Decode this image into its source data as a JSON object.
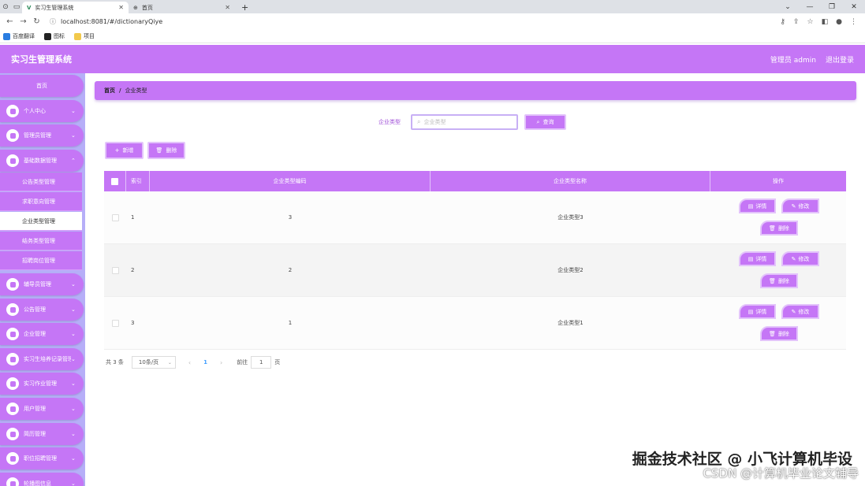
{
  "browser": {
    "tabs": [
      {
        "title": "实习生管理系统",
        "active": true
      },
      {
        "title": "首页",
        "active": false
      }
    ],
    "new_tab": "+",
    "url": "localhost:8081/#/dictionaryQiye",
    "bookmarks": [
      "百度翻译",
      "图标",
      "项目"
    ]
  },
  "header": {
    "title": "实习生管理系统",
    "user": "管理员 admin",
    "logout": "退出登录"
  },
  "sidebar": {
    "home": "首页",
    "menus": [
      {
        "label": "个人中心"
      },
      {
        "label": "管理员管理"
      },
      {
        "label": "基础数据管理"
      }
    ],
    "submenus": [
      "公告类型管理",
      "求职意向管理",
      "企业类型管理",
      "结务类型管理",
      "招聘岗位管理"
    ],
    "menus_after": [
      {
        "label": "辅导员管理"
      },
      {
        "label": "公告管理"
      },
      {
        "label": "企业管理"
      },
      {
        "label": "实习生培养记录管理"
      },
      {
        "label": "实习作业管理"
      },
      {
        "label": "用户管理"
      },
      {
        "label": "简历管理"
      },
      {
        "label": "职位招聘管理"
      },
      {
        "label": "轮播图信息"
      }
    ]
  },
  "breadcrumb": {
    "home": "首页",
    "sep": "/",
    "current": "企业类型"
  },
  "search": {
    "label": "企业类型",
    "placeholder": "企业类型",
    "button": "查询"
  },
  "toolbar": {
    "add": "新增",
    "delete": "删除"
  },
  "table": {
    "headers": {
      "index": "索引",
      "code": "企业类型编码",
      "name": "企业类型名称",
      "ops": "操作"
    },
    "rows": [
      {
        "index": "1",
        "code": "3",
        "name": "企业类型3"
      },
      {
        "index": "2",
        "code": "2",
        "name": "企业类型2"
      },
      {
        "index": "3",
        "code": "1",
        "name": "企业类型1"
      }
    ],
    "ops": {
      "detail": "详情",
      "edit": "修改",
      "delete": "删除"
    }
  },
  "pager": {
    "total": "共 3 条",
    "page_size": "10条/页",
    "current": "1",
    "goto_label": "前往",
    "goto_value": "1",
    "goto_suffix": "页"
  },
  "watermark": {
    "line1": "掘金技术社区 @ 小飞计算机毕设",
    "line2": "CSDN @计算机毕业论文辅导"
  },
  "colors": {
    "accent": "#c576f6",
    "sidebar_bg": "#b6aef8"
  }
}
